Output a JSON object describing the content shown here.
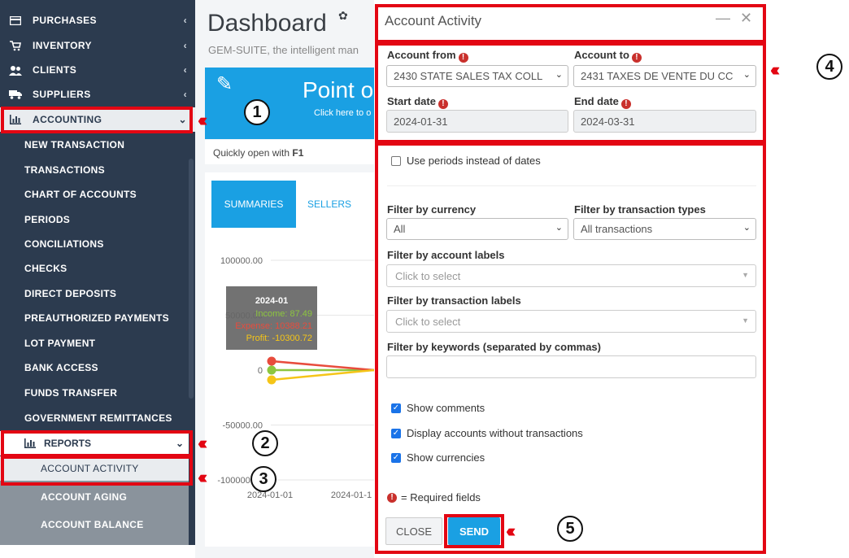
{
  "sidebar": {
    "top_items": [
      {
        "label": "PURCHASES"
      },
      {
        "label": "INVENTORY"
      },
      {
        "label": "CLIENTS"
      },
      {
        "label": "SUPPLIERS"
      },
      {
        "label": "ACCOUNTING"
      }
    ],
    "accounting_items": [
      {
        "label": "NEW TRANSACTION"
      },
      {
        "label": "TRANSACTIONS"
      },
      {
        "label": "CHART OF ACCOUNTS"
      },
      {
        "label": "PERIODS"
      },
      {
        "label": "CONCILIATIONS"
      },
      {
        "label": "CHECKS"
      },
      {
        "label": "DIRECT DEPOSITS"
      },
      {
        "label": "PREAUTHORIZED PAYMENTS"
      },
      {
        "label": "LOT PAYMENT"
      },
      {
        "label": "BANK ACCESS"
      },
      {
        "label": "FUNDS TRANSFER"
      },
      {
        "label": "GOVERNMENT REMITTANCES"
      }
    ],
    "reports_label": "REPORTS",
    "reports_items": [
      {
        "label": "ACCOUNT ACTIVITY"
      },
      {
        "label": "ACCOUNT AGING"
      },
      {
        "label": "ACCOUNT BALANCE"
      }
    ]
  },
  "dashboard": {
    "title": "Dashboard",
    "subtitle": "GEM-SUITE, the intelligent man",
    "poc_title": "Point o",
    "poc_sub": "Click here to o",
    "quick_open": "Quickly open with",
    "quick_key": "F1",
    "tabs": [
      {
        "label": "SUMMARIES"
      },
      {
        "label": "SELLERS"
      }
    ]
  },
  "chart_data": {
    "type": "line",
    "y_ticks": [
      "100000.00",
      "50000.00",
      "0",
      "-50000.00",
      "-100000.00"
    ],
    "ylim": [
      -100000,
      100000
    ],
    "x_ticks": [
      "2024-01-01",
      "2024-01-1"
    ],
    "series": [
      {
        "name": "Income",
        "color": "#8dc63f",
        "values": [
          87.49
        ]
      },
      {
        "name": "Expense",
        "color": "#e84c3d",
        "values": [
          10388.21
        ]
      },
      {
        "name": "Profit",
        "color": "#f5c518",
        "values": [
          -10300.72
        ]
      }
    ],
    "tooltip": {
      "title": "2024-01",
      "income": "Income: 87.49",
      "expense": "Expense: 10388.21",
      "profit": "Profit: -10300.72"
    }
  },
  "modal": {
    "title": "Account Activity",
    "account_from_label": "Account from",
    "account_from_value": "2430 STATE SALES TAX COLL",
    "account_to_label": "Account to",
    "account_to_value": "2431 TAXES DE VENTE DU CC",
    "start_date_label": "Start date",
    "start_date_value": "2024-01-31",
    "end_date_label": "End date",
    "end_date_value": "2024-03-31",
    "use_periods_label": "Use periods instead of dates",
    "currency_label": "Filter by currency",
    "currency_value": "All",
    "trans_types_label": "Filter by transaction types",
    "trans_types_value": "All transactions",
    "account_labels_label": "Filter by account labels",
    "account_labels_placeholder": "Click to select",
    "trans_labels_label": "Filter by transaction labels",
    "trans_labels_placeholder": "Click to select",
    "keywords_label": "Filter by keywords (separated by commas)",
    "keywords_value": "",
    "show_comments_label": "Show comments",
    "display_accounts_label": "Display accounts without transactions",
    "show_currencies_label": "Show currencies",
    "required_note": "= Required fields",
    "close_label": "CLOSE",
    "send_label": "SEND"
  },
  "annotations": {
    "n1": "1",
    "n2": "2",
    "n3": "3",
    "n4": "4",
    "n5": "5",
    "arrow_color": "#e30613"
  },
  "colors": {
    "sidebar_bg": "#2c3b4f",
    "accent": "#1aa0e3",
    "highlight": "#e30613"
  }
}
